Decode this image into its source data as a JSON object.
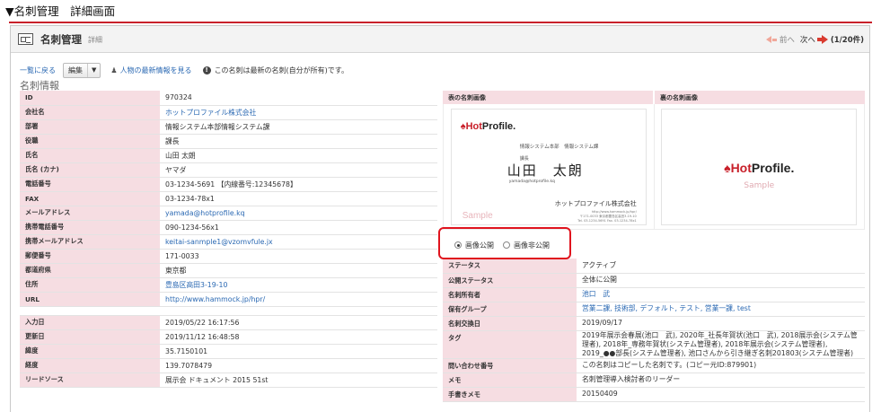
{
  "caption": "▼名刺管理　詳細画面",
  "header": {
    "title": "名刺管理",
    "subtitle": "詳細",
    "prev_label": "前へ",
    "next_label": "次へ",
    "count": "(1/20件)"
  },
  "actions": {
    "back_link": "一覧に戻る",
    "edit_label": "編集",
    "latest_info_link": "人物の最新情報を見る",
    "info_text": "この名刺は最新の名刺(自分が所有)です。"
  },
  "section_title": "名刺情報",
  "left_fields": [
    {
      "label": "ID",
      "value": "970324"
    },
    {
      "label": "会社名",
      "value": "ホットプロファイル株式会社",
      "link": true
    },
    {
      "label": "部署",
      "value": "情報システム本部情報システム課"
    },
    {
      "label": "役職",
      "value": "課長"
    },
    {
      "label": "氏名",
      "value": "山田 太朗"
    },
    {
      "label": "氏名 (カナ)",
      "value": "ヤマダ"
    },
    {
      "label": "電話番号",
      "value": "03-1234-5691 【内線番号:12345678】"
    },
    {
      "label": "FAX",
      "value": "03-1234-78x1"
    },
    {
      "label": "メールアドレス",
      "value": "yamada@hotprofile.kq",
      "link": true
    },
    {
      "label": "携帯電話番号",
      "value": "090-1234-56x1"
    },
    {
      "label": "携帯メールアドレス",
      "value": "keitai-sanmple1@vzomvfule.jx",
      "link": true
    },
    {
      "label": "郵便番号",
      "value": "171-0033"
    },
    {
      "label": "都道府県",
      "value": "東京都"
    },
    {
      "label": "住所",
      "value": "豊島区高田3-19-10",
      "link": true
    },
    {
      "label": "URL",
      "value": "http://www.hammock.jp/hpr/",
      "link": true
    }
  ],
  "left_fields_2": [
    {
      "label": "入力日",
      "value": "2019/05/22 16:17:56"
    },
    {
      "label": "更新日",
      "value": "2019/11/12 16:48:58"
    },
    {
      "label": "緯度",
      "value": "35.7150101"
    },
    {
      "label": "経度",
      "value": "139.7078479"
    },
    {
      "label": "リードソース",
      "value": "展示会 ドキュメント 2015 51st"
    }
  ],
  "cards": {
    "front_header": "表の名刺画像",
    "back_header": "裏の名刺画像",
    "logo_hot": "♠Hot",
    "logo_profile": "Profile.",
    "front_dept": "情報システム本部　情報システム課",
    "front_role": "課長",
    "front_name": "山田　太朗",
    "front_mail": "yamada@hotprofile.kq",
    "front_company": "ホットプロファイル株式会社",
    "front_addr_1": "http://www.hammock.jp/hpr/",
    "front_addr_2": "〒171-0033 東京都豊島区高田3-19-10",
    "front_addr_3": "Tel. 03-1234-5691 Fax. 03-1234-78x1",
    "sample": "Sample"
  },
  "publish": {
    "public_label": "画像公開",
    "private_label": "画像非公開"
  },
  "right_fields": [
    {
      "label": "ステータス",
      "value": "アクティブ"
    },
    {
      "label": "公開ステータス",
      "value": "全体に公開"
    },
    {
      "label": "名刺所有者",
      "value": "池口　武",
      "link": true
    },
    {
      "label": "保有グループ",
      "value": "営業二課, 技術部, デフォルト, テスト, 営業一課, test",
      "link": true
    },
    {
      "label": "名刺交換日",
      "value": "2019/09/17"
    },
    {
      "label": "タグ",
      "value": "2019年展示会春展(池口　武), 2020年_社長年賀状(池口　武), 2018展示会(システム管理者), 2018年_専務年賀状(システム管理者), 2018年展示会(システム管理者), 2019_●●部長(システム管理者), 池口さんから引き継ぎ名刺201803(システム管理者)"
    },
    {
      "label": "",
      "value": ""
    },
    {
      "label": "問い合わせ番号",
      "value": "この名刺はコピーした名刺です。(コピー元ID:879901)"
    },
    {
      "label": "メモ",
      "value": "名刺管理導入検討者のリーダー"
    },
    {
      "label": "手書きメモ",
      "value": "20150409"
    }
  ]
}
